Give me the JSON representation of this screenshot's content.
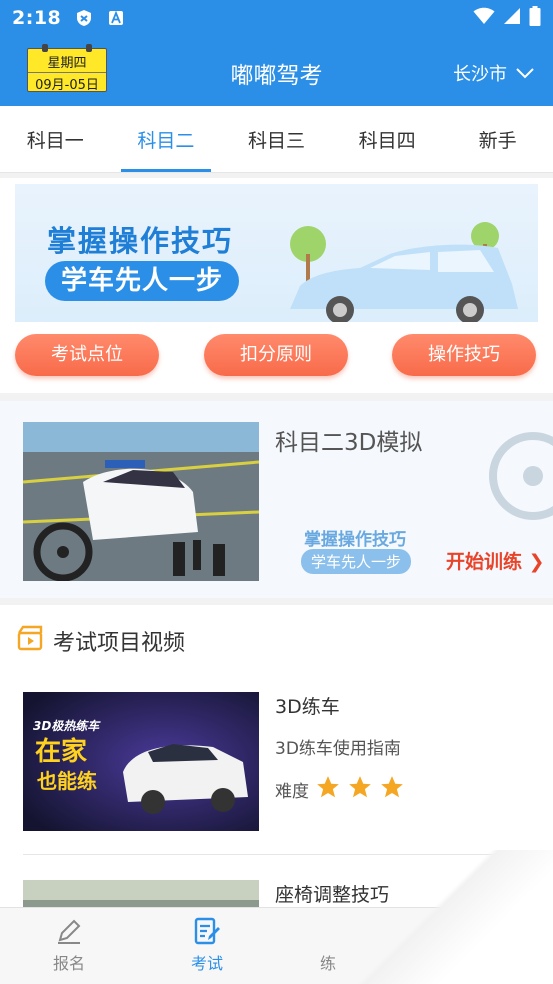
{
  "status_bar": {
    "time": "2:18"
  },
  "header": {
    "weekday": "星期四",
    "date": "09月-05日",
    "title": "嘟嘟驾考",
    "city": "长沙市"
  },
  "tabs": [
    {
      "label": "科目一",
      "active": false
    },
    {
      "label": "科目二",
      "active": true
    },
    {
      "label": "科目三",
      "active": false
    },
    {
      "label": "科目四",
      "active": false
    },
    {
      "label": "新手",
      "active": false
    }
  ],
  "banner": {
    "line1": "掌握操作技巧",
    "line2": "学车先人一步"
  },
  "quick_buttons": [
    "考试点位",
    "扣分原则",
    "操作技巧"
  ],
  "simulator": {
    "title": "科目二3D模拟",
    "slogan1": "掌握操作技巧",
    "slogan2": "学车先人一步",
    "start_label": "开始训练"
  },
  "videos": {
    "section_title": "考试项目视频",
    "items": [
      {
        "title": "3D练车",
        "desc": "3D练车使用指南",
        "difficulty_label": "难度",
        "stars": 3,
        "thumb_text1": "3D极热练车",
        "thumb_text2": "在家",
        "thumb_text3": "也能练"
      },
      {
        "title": "座椅调整技巧"
      }
    ]
  },
  "bottom_nav": [
    {
      "label": "报名",
      "icon": "pen-icon",
      "active": false
    },
    {
      "label": "考试",
      "icon": "exam-icon",
      "active": true
    },
    {
      "label": "练",
      "icon": "practice-icon",
      "active": false
    }
  ],
  "colors": {
    "primary": "#2b8fe8",
    "accent": "#f86b4a",
    "star": "#f5a623"
  }
}
